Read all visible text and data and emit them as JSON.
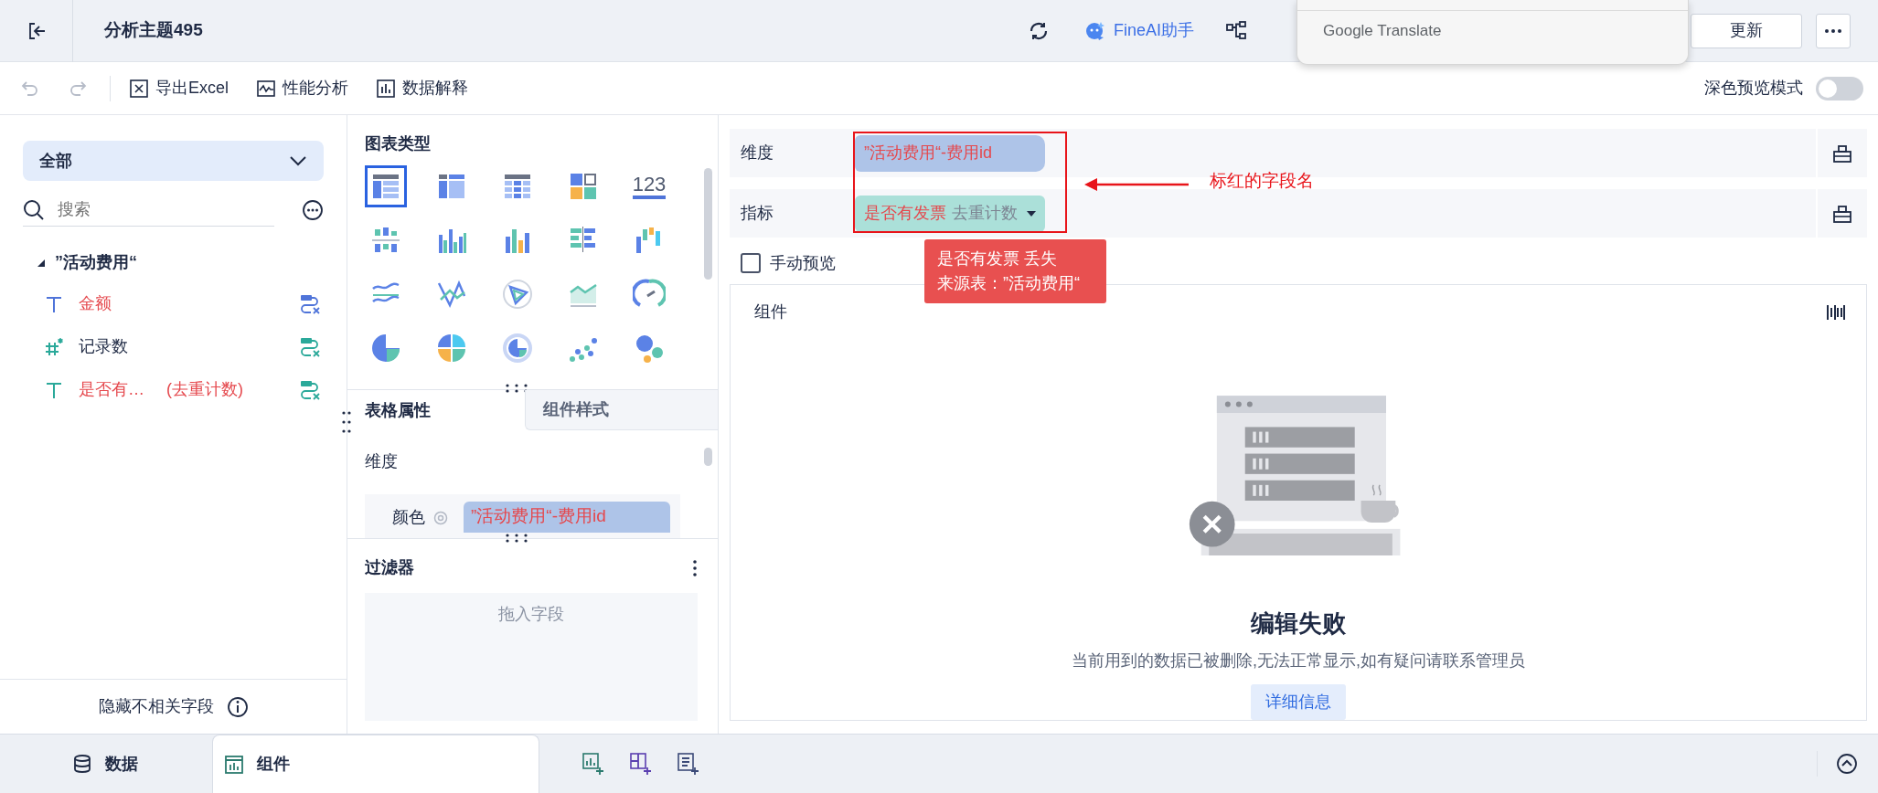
{
  "topbar": {
    "title": "分析主题495",
    "ai_label": "FineAI助手",
    "update_button": "更新"
  },
  "translate_popup": {
    "label": "Google Translate"
  },
  "toolbar": {
    "undo": {
      "disabled": true
    },
    "redo": {
      "disabled": true
    },
    "actions": [
      {
        "kind": "excel",
        "label": "导出Excel"
      },
      {
        "kind": "performance",
        "label": "性能分析"
      },
      {
        "kind": "explain",
        "label": "数据解释"
      }
    ],
    "dark_preview": {
      "label": "深色预览模式",
      "on": false
    }
  },
  "data_panel": {
    "scope": "全部",
    "search_placeholder": "搜索",
    "tables": [
      {
        "name": "”活动费用“",
        "expanded": true,
        "children": [
          {
            "kind": "text",
            "color": "#4f74d9",
            "name": "金额",
            "error": true
          },
          {
            "kind": "count",
            "color": "#2ba99a",
            "name": "记录数",
            "error": false
          },
          {
            "kind": "text",
            "color": "#2ba99a",
            "name": "是否有…",
            "suffix": "(去重计数)",
            "error": true
          }
        ]
      }
    ],
    "footer": "隐藏不相关字段"
  },
  "chart_panel": {
    "title": "图表类型",
    "chart_types": [
      {
        "kind": "table",
        "selected": true
      },
      {
        "kind": "cross_table",
        "selected": false
      },
      {
        "kind": "detail_table",
        "selected": false
      },
      {
        "kind": "kpi",
        "selected": false
      },
      {
        "kind": "number",
        "label": "123",
        "selected": false
      },
      {
        "kind": "stacked",
        "selected": false
      },
      {
        "kind": "multi_bar",
        "selected": false
      },
      {
        "kind": "bar",
        "selected": false
      },
      {
        "kind": "hbar",
        "selected": false
      },
      {
        "kind": "waterfall",
        "selected": false
      },
      {
        "kind": "line_compare",
        "selected": false
      },
      {
        "kind": "line",
        "selected": false
      },
      {
        "kind": "radar",
        "selected": false
      },
      {
        "kind": "area",
        "selected": false
      },
      {
        "kind": "gauge",
        "selected": false
      },
      {
        "kind": "pie",
        "selected": false
      },
      {
        "kind": "multi_pie",
        "selected": false
      },
      {
        "kind": "ring",
        "selected": false
      },
      {
        "kind": "scatter",
        "selected": false
      },
      {
        "kind": "bubble",
        "selected": false
      }
    ]
  },
  "property_tabs": [
    {
      "label": "表格属性",
      "selected": true
    },
    {
      "label": "组件样式",
      "selected": false
    }
  ],
  "properties": {
    "dimension_label": "维度",
    "color_label": "颜色",
    "color_field": {
      "name": "”活动费用“-费用id",
      "error": true
    }
  },
  "filter": {
    "title": "过滤器",
    "placeholder": "拖入字段"
  },
  "shelves": [
    {
      "label": "维度",
      "fields": [
        {
          "name": "”活动费用“-费用id",
          "color": "#aec4e8",
          "error": true
        }
      ]
    },
    {
      "label": "指标",
      "fields": [
        {
          "name": "是否有发票",
          "aggregation": "去重计数",
          "color": "#abe0d9",
          "error": true
        }
      ]
    }
  ],
  "annotation": {
    "label": "标红的字段名"
  },
  "tooltip": {
    "lines": [
      "是否有发票 丢失",
      "来源表：”活动费用“"
    ]
  },
  "manual_preview": {
    "label": "手动预览",
    "checked": false
  },
  "component": {
    "title": "组件",
    "error_title": "编辑失败",
    "error_message": "当前用到的数据已被删除,无法正常显示,如有疑问请联系管理员",
    "details_button": "详细信息"
  },
  "bottom_tabs": [
    {
      "kind": "data",
      "label": "数据",
      "selected": false
    },
    {
      "kind": "component",
      "label": "组件",
      "selected": true
    }
  ]
}
